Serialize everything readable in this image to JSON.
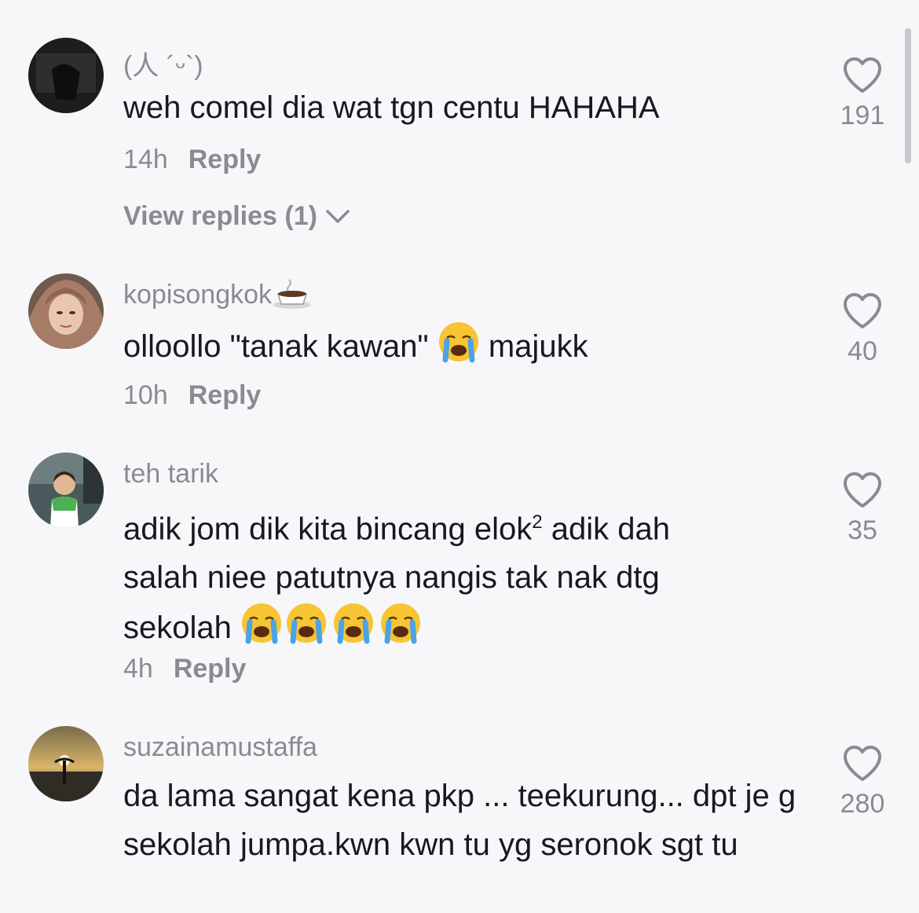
{
  "comments": [
    {
      "username": "(人 ´ᵕ`)",
      "text": "weh comel dia wat tgn centu HAHAHA",
      "time": "14h",
      "reply_label": "Reply",
      "view_replies": "View replies (1)",
      "likes": "191"
    },
    {
      "username": "kopisongkok",
      "username_emoji": "coffee-cup",
      "text_before": "olloollo \"tanak kawan\" ",
      "text_after": " majukk",
      "time": "10h",
      "reply_label": "Reply",
      "likes": "40"
    },
    {
      "username": "teh tarik",
      "text_line1": "adik jom dik kita bincang elok",
      "superscript": "2",
      "text_line1_tail": " adik dah",
      "text_line2": "salah niee patutnya nangis tak nak dtg",
      "text_line3": "sekolah ",
      "time": "4h",
      "reply_label": "Reply",
      "likes": "35"
    },
    {
      "username": "suzainamustaffa",
      "text": "da lama sangat kena pkp ... teekurung... dpt je g sekolah jumpa.kwn kwn tu yg seronok sgt tu",
      "likes": "280"
    }
  ],
  "colors": {
    "primary_text": "#161823",
    "secondary_text": "#8a8b91",
    "background": "#f7f7f9"
  }
}
